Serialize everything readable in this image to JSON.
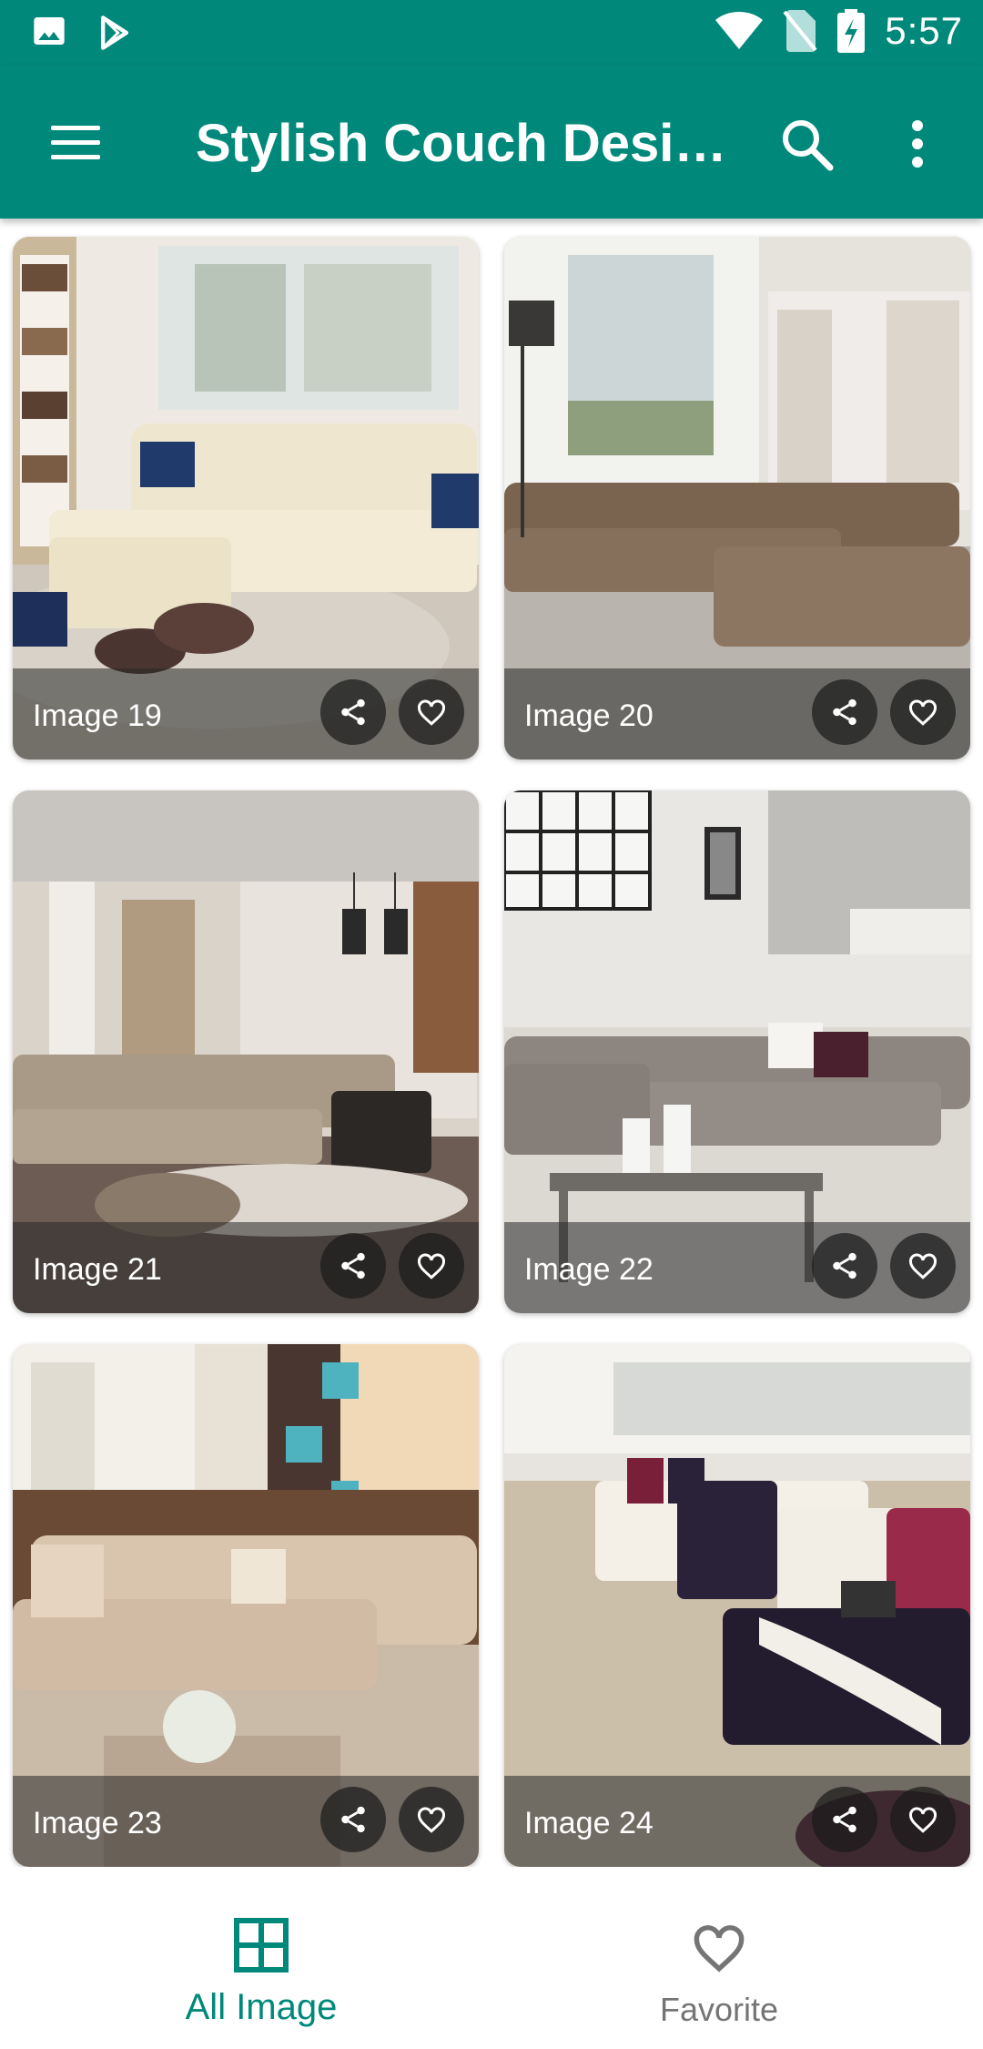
{
  "status_bar": {
    "time": "5:57",
    "icons": [
      "image-icon",
      "play-store-icon",
      "wifi-icon",
      "no-sim-icon",
      "battery-charging-icon"
    ]
  },
  "app_bar": {
    "title": "Stylish Couch Desig...",
    "icons": [
      "menu-icon",
      "search-icon",
      "more-vert-icon"
    ]
  },
  "cards": [
    {
      "caption": "Image 19"
    },
    {
      "caption": "Image 20"
    },
    {
      "caption": "Image 21"
    },
    {
      "caption": "Image 22"
    },
    {
      "caption": "Image 23"
    },
    {
      "caption": "Image 24"
    }
  ],
  "bottom_nav": {
    "items": [
      {
        "label": "All Image",
        "icon": "grid-icon",
        "active": true
      },
      {
        "label": "Favorite",
        "icon": "heart-outline-icon",
        "active": false
      }
    ]
  },
  "colors": {
    "primary": "#00897b",
    "inactive": "#757575"
  }
}
